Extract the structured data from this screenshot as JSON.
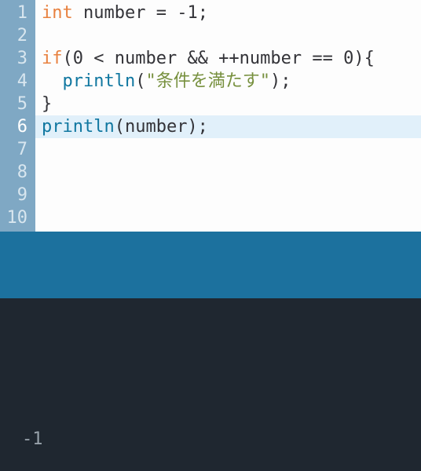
{
  "editor": {
    "highlighted_line": 6,
    "lines": [
      {
        "num": "1",
        "tokens": [
          {
            "cls": "tok-keyword",
            "text": "int"
          },
          {
            "cls": "tok-default",
            "text": " number = -1;"
          }
        ]
      },
      {
        "num": "2",
        "tokens": []
      },
      {
        "num": "3",
        "tokens": [
          {
            "cls": "tok-keyword",
            "text": "if"
          },
          {
            "cls": "tok-default",
            "text": "(0 < number && ++number == 0){"
          }
        ]
      },
      {
        "num": "4",
        "tokens": [
          {
            "cls": "tok-default",
            "text": "  "
          },
          {
            "cls": "tok-func",
            "text": "println"
          },
          {
            "cls": "tok-default",
            "text": "("
          },
          {
            "cls": "tok-string",
            "text": "\"条件を満たす\""
          },
          {
            "cls": "tok-default",
            "text": ");"
          }
        ]
      },
      {
        "num": "5",
        "tokens": [
          {
            "cls": "tok-default",
            "text": "}"
          }
        ]
      },
      {
        "num": "6",
        "tokens": [
          {
            "cls": "tok-func",
            "text": "println"
          },
          {
            "cls": "tok-default",
            "text": "(number);"
          }
        ]
      },
      {
        "num": "7",
        "tokens": []
      },
      {
        "num": "8",
        "tokens": []
      },
      {
        "num": "9",
        "tokens": []
      },
      {
        "num": "10",
        "tokens": []
      }
    ]
  },
  "console": {
    "output": "-1"
  }
}
